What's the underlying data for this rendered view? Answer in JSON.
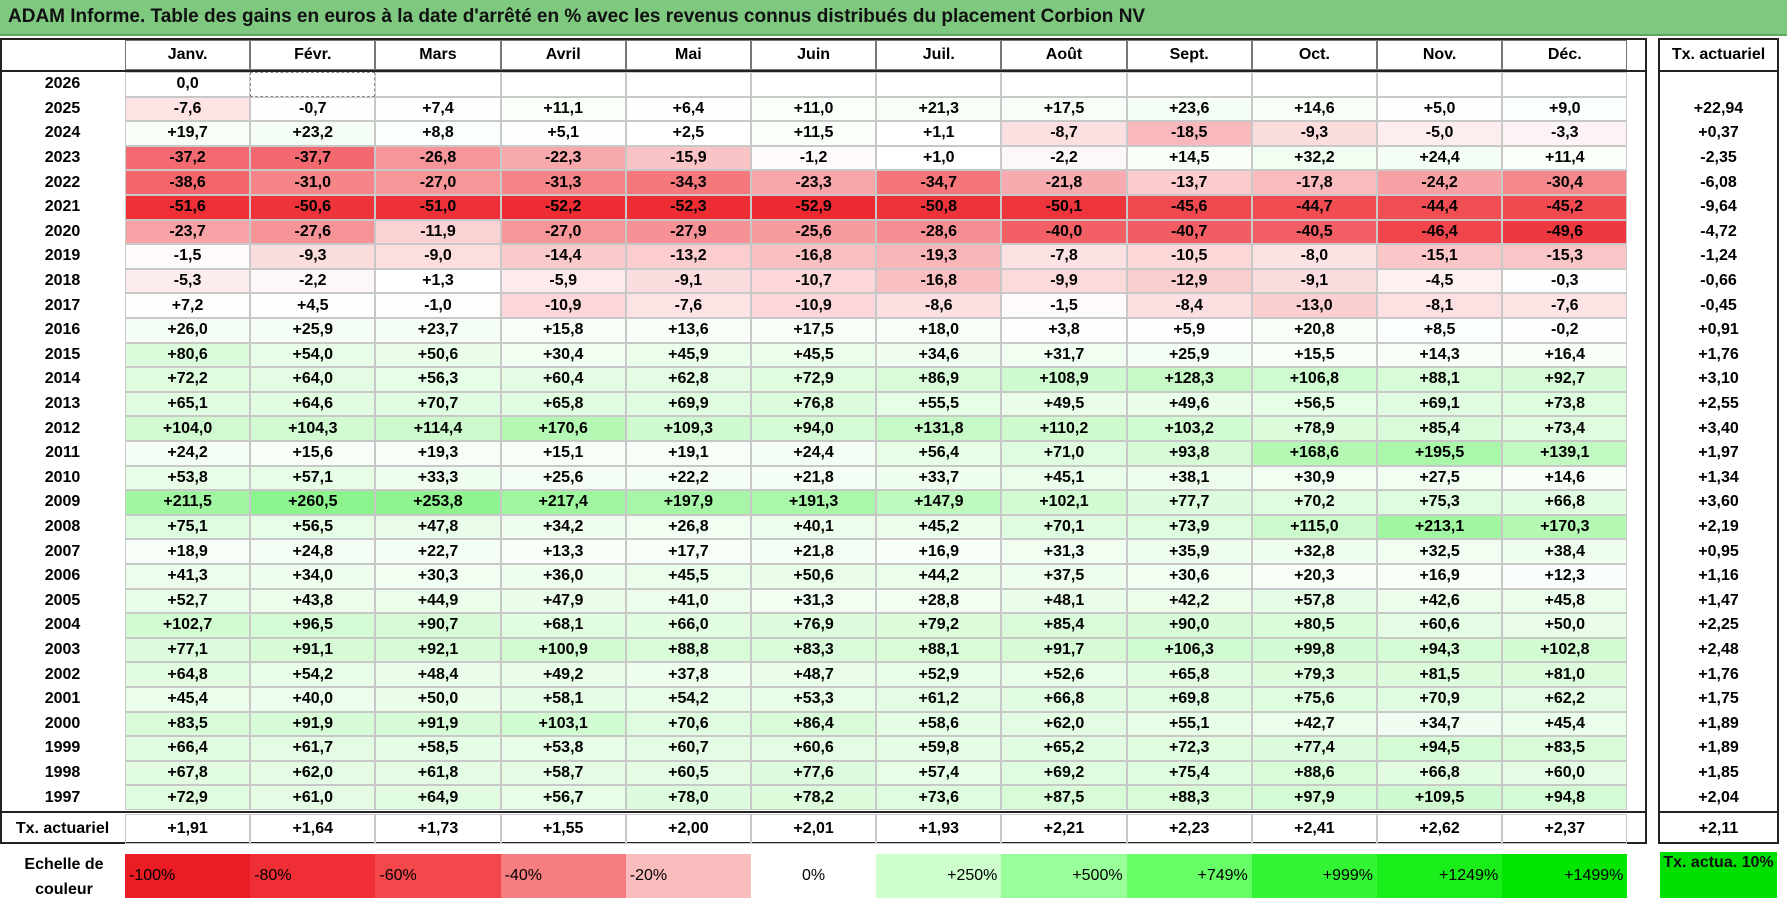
{
  "title": "ADAM Informe. Table des gains en euros à la date d'arrêté en % avec les revenus connus distribués du placement Corbion NV",
  "chart_data": {
    "type": "heatmap",
    "months": [
      "Janv.",
      "Févr.",
      "Mars",
      "Avril",
      "Mai",
      "Juin",
      "Juil.",
      "Août",
      "Sept.",
      "Oct.",
      "Nov.",
      "Déc."
    ],
    "rate_column_label": "Tx. actuariel",
    "rows": [
      {
        "year": "2026",
        "values": [
          "0,0",
          "",
          "",
          "",
          "",
          "",
          "",
          "",
          "",
          "",
          "",
          ""
        ],
        "rate": ""
      },
      {
        "year": "2025",
        "values": [
          "-7,6",
          "-0,7",
          "+7,4",
          "+11,1",
          "+6,4",
          "+11,0",
          "+21,3",
          "+17,5",
          "+23,6",
          "+14,6",
          "+5,0",
          "+9,0"
        ],
        "rate": "+22,94"
      },
      {
        "year": "2024",
        "values": [
          "+19,7",
          "+23,2",
          "+8,8",
          "+5,1",
          "+2,5",
          "+11,5",
          "+1,1",
          "-8,7",
          "-18,5",
          "-9,3",
          "-5,0",
          "-3,3"
        ],
        "rate": "+0,37"
      },
      {
        "year": "2023",
        "values": [
          "-37,2",
          "-37,7",
          "-26,8",
          "-22,3",
          "-15,9",
          "-1,2",
          "+1,0",
          "-2,2",
          "+14,5",
          "+32,2",
          "+24,4",
          "+11,4"
        ],
        "rate": "-2,35"
      },
      {
        "year": "2022",
        "values": [
          "-38,6",
          "-31,0",
          "-27,0",
          "-31,3",
          "-34,3",
          "-23,3",
          "-34,7",
          "-21,8",
          "-13,7",
          "-17,8",
          "-24,2",
          "-30,4"
        ],
        "rate": "-6,08"
      },
      {
        "year": "2021",
        "values": [
          "-51,6",
          "-50,6",
          "-51,0",
          "-52,2",
          "-52,3",
          "-52,9",
          "-50,8",
          "-50,1",
          "-45,6",
          "-44,7",
          "-44,4",
          "-45,2"
        ],
        "rate": "-9,64"
      },
      {
        "year": "2020",
        "values": [
          "-23,7",
          "-27,6",
          "-11,9",
          "-27,0",
          "-27,9",
          "-25,6",
          "-28,6",
          "-40,0",
          "-40,7",
          "-40,5",
          "-46,4",
          "-49,6"
        ],
        "rate": "-4,72"
      },
      {
        "year": "2019",
        "values": [
          "-1,5",
          "-9,3",
          "-9,0",
          "-14,4",
          "-13,2",
          "-16,8",
          "-19,3",
          "-7,8",
          "-10,5",
          "-8,0",
          "-15,1",
          "-15,3"
        ],
        "rate": "-1,24"
      },
      {
        "year": "2018",
        "values": [
          "-5,3",
          "-2,2",
          "+1,3",
          "-5,9",
          "-9,1",
          "-10,7",
          "-16,8",
          "-9,9",
          "-12,9",
          "-9,1",
          "-4,5",
          "-0,3"
        ],
        "rate": "-0,66"
      },
      {
        "year": "2017",
        "values": [
          "+7,2",
          "+4,5",
          "-1,0",
          "-10,9",
          "-7,6",
          "-10,9",
          "-8,6",
          "-1,5",
          "-8,4",
          "-13,0",
          "-8,1",
          "-7,6"
        ],
        "rate": "-0,45"
      },
      {
        "year": "2016",
        "values": [
          "+26,0",
          "+25,9",
          "+23,7",
          "+15,8",
          "+13,6",
          "+17,5",
          "+18,0",
          "+3,8",
          "+5,9",
          "+20,8",
          "+8,5",
          "-0,2"
        ],
        "rate": "+0,91"
      },
      {
        "year": "2015",
        "values": [
          "+80,6",
          "+54,0",
          "+50,6",
          "+30,4",
          "+45,9",
          "+45,5",
          "+34,6",
          "+31,7",
          "+25,9",
          "+15,5",
          "+14,3",
          "+16,4"
        ],
        "rate": "+1,76"
      },
      {
        "year": "2014",
        "values": [
          "+72,2",
          "+64,0",
          "+56,3",
          "+60,4",
          "+62,8",
          "+72,9",
          "+86,9",
          "+108,9",
          "+128,3",
          "+106,8",
          "+88,1",
          "+92,7"
        ],
        "rate": "+3,10"
      },
      {
        "year": "2013",
        "values": [
          "+65,1",
          "+64,6",
          "+70,7",
          "+65,8",
          "+69,9",
          "+76,8",
          "+55,5",
          "+49,5",
          "+49,6",
          "+56,5",
          "+69,1",
          "+73,8"
        ],
        "rate": "+2,55"
      },
      {
        "year": "2012",
        "values": [
          "+104,0",
          "+104,3",
          "+114,4",
          "+170,6",
          "+109,3",
          "+94,0",
          "+131,8",
          "+110,2",
          "+103,2",
          "+78,9",
          "+85,4",
          "+73,4"
        ],
        "rate": "+3,40"
      },
      {
        "year": "2011",
        "values": [
          "+24,2",
          "+15,6",
          "+19,3",
          "+15,1",
          "+19,1",
          "+24,4",
          "+56,4",
          "+71,0",
          "+93,8",
          "+168,6",
          "+195,5",
          "+139,1"
        ],
        "rate": "+1,97"
      },
      {
        "year": "2010",
        "values": [
          "+53,8",
          "+57,1",
          "+33,3",
          "+25,6",
          "+22,2",
          "+21,8",
          "+33,7",
          "+45,1",
          "+38,1",
          "+30,9",
          "+27,5",
          "+14,6"
        ],
        "rate": "+1,34"
      },
      {
        "year": "2009",
        "values": [
          "+211,5",
          "+260,5",
          "+253,8",
          "+217,4",
          "+197,9",
          "+191,3",
          "+147,9",
          "+102,1",
          "+77,7",
          "+70,2",
          "+75,3",
          "+66,8"
        ],
        "rate": "+3,60"
      },
      {
        "year": "2008",
        "values": [
          "+75,1",
          "+56,5",
          "+47,8",
          "+34,2",
          "+26,8",
          "+40,1",
          "+45,2",
          "+70,1",
          "+73,9",
          "+115,0",
          "+213,1",
          "+170,3"
        ],
        "rate": "+2,19"
      },
      {
        "year": "2007",
        "values": [
          "+18,9",
          "+24,8",
          "+22,7",
          "+13,3",
          "+17,7",
          "+21,8",
          "+16,9",
          "+31,3",
          "+35,9",
          "+32,8",
          "+32,5",
          "+38,4"
        ],
        "rate": "+0,95"
      },
      {
        "year": "2006",
        "values": [
          "+41,3",
          "+34,0",
          "+30,3",
          "+36,0",
          "+45,5",
          "+50,6",
          "+44,2",
          "+37,5",
          "+30,6",
          "+20,3",
          "+16,9",
          "+12,3"
        ],
        "rate": "+1,16"
      },
      {
        "year": "2005",
        "values": [
          "+52,7",
          "+43,8",
          "+44,9",
          "+47,9",
          "+41,0",
          "+31,3",
          "+28,8",
          "+48,1",
          "+42,2",
          "+57,8",
          "+42,6",
          "+45,8"
        ],
        "rate": "+1,47"
      },
      {
        "year": "2004",
        "values": [
          "+102,7",
          "+96,5",
          "+90,7",
          "+68,1",
          "+66,0",
          "+76,9",
          "+79,2",
          "+85,4",
          "+90,0",
          "+80,5",
          "+60,6",
          "+50,0"
        ],
        "rate": "+2,25"
      },
      {
        "year": "2003",
        "values": [
          "+77,1",
          "+91,1",
          "+92,1",
          "+100,9",
          "+88,8",
          "+83,3",
          "+88,1",
          "+91,7",
          "+106,3",
          "+99,8",
          "+94,3",
          "+102,8"
        ],
        "rate": "+2,48"
      },
      {
        "year": "2002",
        "values": [
          "+64,8",
          "+54,2",
          "+48,4",
          "+49,2",
          "+37,8",
          "+48,7",
          "+52,9",
          "+52,6",
          "+65,8",
          "+79,3",
          "+81,5",
          "+81,0"
        ],
        "rate": "+1,76"
      },
      {
        "year": "2001",
        "values": [
          "+45,4",
          "+40,0",
          "+50,0",
          "+58,1",
          "+54,2",
          "+53,3",
          "+61,2",
          "+66,8",
          "+69,8",
          "+75,6",
          "+70,9",
          "+62,2"
        ],
        "rate": "+1,75"
      },
      {
        "year": "2000",
        "values": [
          "+83,5",
          "+91,9",
          "+91,9",
          "+103,1",
          "+70,6",
          "+86,4",
          "+58,6",
          "+62,0",
          "+55,1",
          "+42,7",
          "+34,7",
          "+45,4"
        ],
        "rate": "+1,89"
      },
      {
        "year": "1999",
        "values": [
          "+66,4",
          "+61,7",
          "+58,5",
          "+53,8",
          "+60,7",
          "+60,6",
          "+59,8",
          "+65,2",
          "+72,3",
          "+77,4",
          "+94,5",
          "+83,5"
        ],
        "rate": "+1,89"
      },
      {
        "year": "1998",
        "values": [
          "+67,8",
          "+62,0",
          "+61,8",
          "+58,7",
          "+60,5",
          "+77,6",
          "+57,4",
          "+69,2",
          "+75,4",
          "+88,6",
          "+66,8",
          "+60,0"
        ],
        "rate": "+1,85"
      },
      {
        "year": "1997",
        "values": [
          "+72,9",
          "+61,0",
          "+64,9",
          "+56,7",
          "+78,0",
          "+78,2",
          "+73,6",
          "+87,5",
          "+88,3",
          "+97,9",
          "+109,5",
          "+94,8"
        ],
        "rate": "+2,04"
      }
    ],
    "footer_row": {
      "label": "Tx. actuariel",
      "values": [
        "+1,91",
        "+1,64",
        "+1,73",
        "+1,55",
        "+2,00",
        "+2,01",
        "+1,93",
        "+2,21",
        "+2,23",
        "+2,41",
        "+2,62",
        "+2,37"
      ],
      "rate": "+2,11"
    },
    "color_scale": {
      "label": "Echelle de couleur",
      "stops": [
        {
          "label": "-100%",
          "pct": -100,
          "color": "#ec1c24"
        },
        {
          "label": "-80%",
          "pct": -80,
          "color": "#ef2f35"
        },
        {
          "label": "-60%",
          "pct": -60,
          "color": "#f3474b"
        },
        {
          "label": "-40%",
          "pct": -40,
          "color": "#f77e80"
        },
        {
          "label": "-20%",
          "pct": -20,
          "color": "#fbbcbd"
        },
        {
          "label": "0%",
          "pct": 0,
          "color": "#ffffff"
        },
        {
          "label": "+250%",
          "pct": 250,
          "color": "#ccffcc"
        },
        {
          "label": "+500%",
          "pct": 500,
          "color": "#99ff99"
        },
        {
          "label": "+749%",
          "pct": 749,
          "color": "#66ff66"
        },
        {
          "label": "+999%",
          "pct": 999,
          "color": "#33f533"
        },
        {
          "label": "+1249%",
          "pct": 1249,
          "color": "#1aee1a"
        },
        {
          "label": "+1499%",
          "pct": 1499,
          "color": "#00e600"
        }
      ],
      "rate_legend": "Tx. actua. 10%",
      "rate_legend_color": "#00e000"
    },
    "colors": {
      "title_bg": "#7ec87f",
      "negative_max": "#ec1c24",
      "positive_max": "#00e600"
    }
  }
}
